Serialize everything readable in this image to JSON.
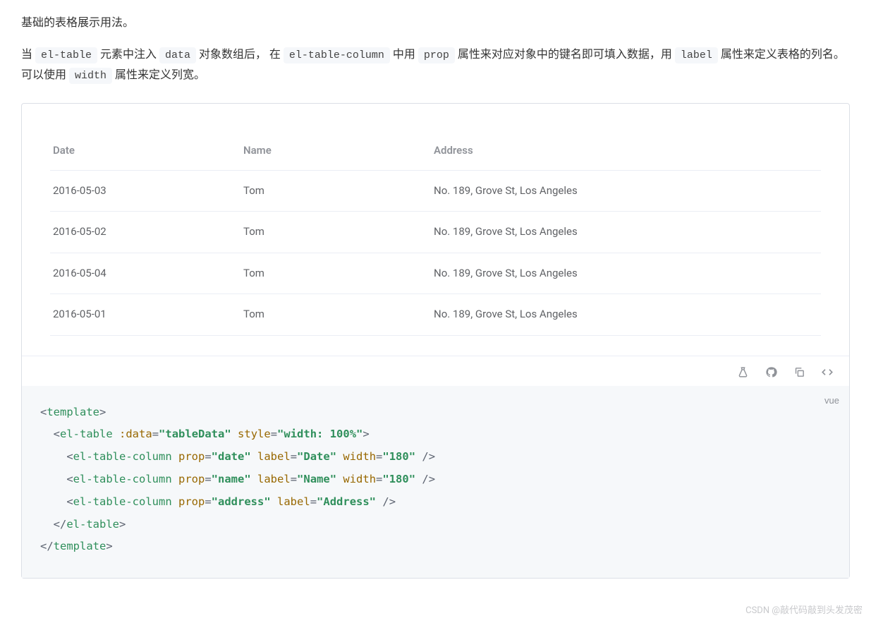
{
  "intro": {
    "line1": "基础的表格展示用法。",
    "p2_1": "当 ",
    "code_el_table": "el-table",
    "p2_2": " 元素中注入 ",
    "code_data": "data",
    "p2_3": " 对象数组后， 在 ",
    "code_el_table_column": "el-table-column",
    "p2_4": " 中用 ",
    "code_prop": "prop",
    "p2_5": " 属性来对应对象中的键名即可填入数据，用 ",
    "code_label": "label",
    "p2_6": " 属性来定义表格的列名。 可以使用 ",
    "code_width": "width",
    "p2_7": " 属性来定义列宽。"
  },
  "table": {
    "headers": {
      "date": "Date",
      "name": "Name",
      "address": "Address"
    },
    "rows": [
      {
        "date": "2016-05-03",
        "name": "Tom",
        "address": "No. 189, Grove St, Los Angeles"
      },
      {
        "date": "2016-05-02",
        "name": "Tom",
        "address": "No. 189, Grove St, Los Angeles"
      },
      {
        "date": "2016-05-04",
        "name": "Tom",
        "address": "No. 189, Grove St, Los Angeles"
      },
      {
        "date": "2016-05-01",
        "name": "Tom",
        "address": "No. 189, Grove St, Los Angeles"
      }
    ]
  },
  "code": {
    "lang": "vue",
    "template_open": "template",
    "el_table": "el-table",
    "data_attr": ":data",
    "data_val": "\"tableData\"",
    "style_attr": "style",
    "style_val": "\"width: 100%\"",
    "el_col": "el-table-column",
    "prop_attr": "prop",
    "label_attr": "label",
    "width_attr": "width",
    "col1_prop": "\"date\"",
    "col1_label": "\"Date\"",
    "col1_width": "\"180\"",
    "col2_prop": "\"name\"",
    "col2_label": "\"Name\"",
    "col2_width": "\"180\"",
    "col3_prop": "\"address\"",
    "col3_label": "\"Address\""
  },
  "watermark": "CSDN @敲代码敲到头发茂密"
}
